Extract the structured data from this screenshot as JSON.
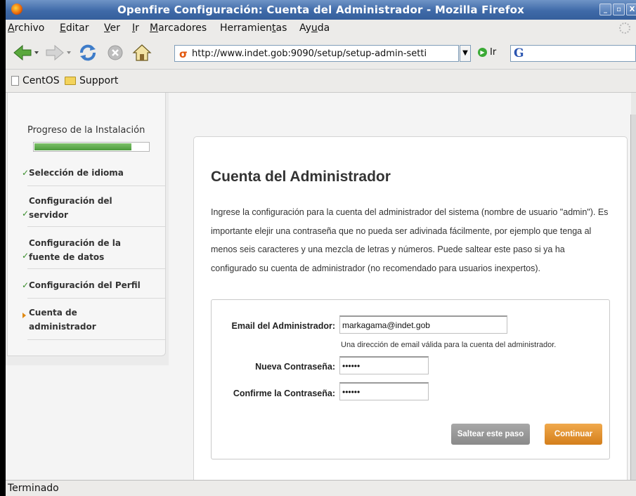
{
  "window": {
    "title": "Openfire Configuración: Cuenta del Administrador - Mozilla Firefox",
    "minimize_label": "_",
    "maximize_label": "▫",
    "close_label": "X"
  },
  "menu": [
    {
      "label": "Archivo",
      "key": "A"
    },
    {
      "label": "Editar",
      "key": "E"
    },
    {
      "label": "Ver",
      "key": "V"
    },
    {
      "label": "Ir",
      "key": "I"
    },
    {
      "label": "Marcadores",
      "key": "M"
    },
    {
      "label": "Herramientas",
      "key": "t"
    },
    {
      "label": "Ayuda",
      "key": "u"
    }
  ],
  "menu_text": {
    "archivo_rest": "rchivo",
    "editar_rest": "ditar",
    "ver_rest": "er",
    "ir_rest": "r",
    "marcadores_rest": "arcadores",
    "herramientas_a": "Herramien",
    "herramientas_b": "as",
    "ayuda_a": "Ay",
    "ayuda_b": "da"
  },
  "navbar": {
    "url": "http://www.indet.gob:9090/setup/setup-admin-setti",
    "go_label": "Ir",
    "search_engine_icon": "google-icon",
    "search_glyph": "G"
  },
  "bookmarks": [
    {
      "label": "CentOS",
      "icon": "page-icon"
    },
    {
      "label": "Support",
      "icon": "folder-icon"
    }
  ],
  "sidebar": {
    "progress_label": "Progreso de la Instalación",
    "progress_fraction": 0.85,
    "steps": [
      {
        "line1": "Selección de idioma",
        "line2": "",
        "status": "done"
      },
      {
        "line1": "Configuración del",
        "line2": "servidor",
        "status": "done"
      },
      {
        "line1": "Configuración de la",
        "line2": "fuente de datos",
        "status": "done"
      },
      {
        "line1": "Configuración del Perfil",
        "line2": "",
        "status": "done"
      },
      {
        "line1": "Cuenta de",
        "line2": "administrador",
        "status": "current"
      }
    ],
    "check_glyph": "✓"
  },
  "main": {
    "heading": "Cuenta del Administrador",
    "description": "Ingrese la configuración para la cuenta del administrador del sistema (nombre de usuario \"admin\"). Es importante elejir una contraseña que no pueda ser adivinada fácilmente, por ejemplo que tenga al menos seis caracteres y una mezcla de letras y números. Puede saltear este paso si ya ha configurado su cuenta de administrador (no recomendado para usuarios inexpertos).",
    "form": {
      "email_label": "Email del Administrador:",
      "email_value": "markagama@indet.gob",
      "email_hint": "Una dirección de email válida para la cuenta del administrador.",
      "password_label": "Nueva Contraseña:",
      "password_value": "••••••",
      "confirm_label": "Confirme la Contraseña:",
      "confirm_value": "••••••",
      "skip_button": "Saltear este paso",
      "continue_button": "Continuar"
    }
  },
  "status_bar": {
    "text": "Terminado"
  },
  "colors": {
    "titlebar": "#3f6aa8",
    "continue_button": "#d47f1c",
    "skip_button": "#8a8a8a",
    "progress": "#4c9a3c",
    "check": "#3a8e2c"
  }
}
